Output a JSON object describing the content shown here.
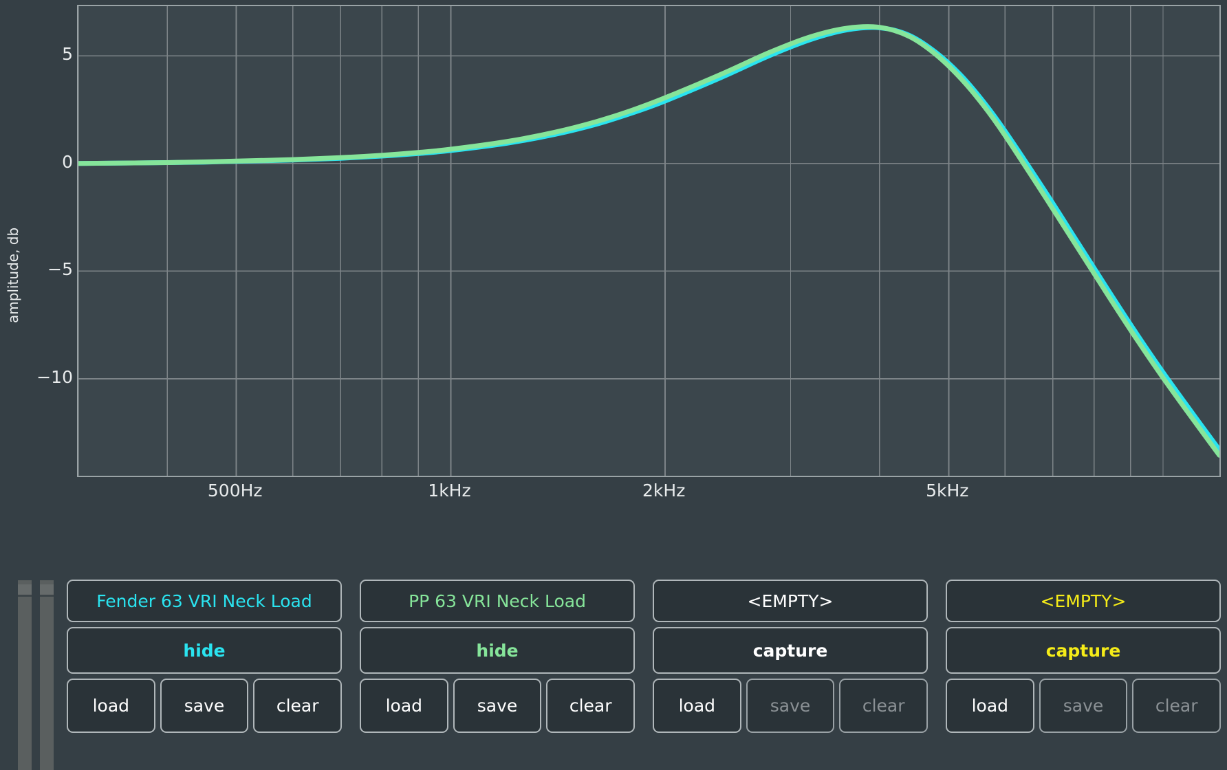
{
  "plot": {
    "y_axis_title": "amplitude, db",
    "y_ticks": [
      {
        "label": "5",
        "value": 5
      },
      {
        "label": "0",
        "value": 0
      },
      {
        "label": "−5",
        "value": -5
      },
      {
        "label": "−10",
        "value": -10
      }
    ],
    "x_ticks": [
      {
        "label": "500Hz",
        "value": 500
      },
      {
        "label": "1kHz",
        "value": 1000
      },
      {
        "label": "2kHz",
        "value": 2000
      },
      {
        "label": "5kHz",
        "value": 5000
      }
    ],
    "colors": {
      "background": "#353f45",
      "plot_background": "#3b464c",
      "grid": "#7d8488",
      "axis_border": "#9aa3a6",
      "tick_text": "#e9eced",
      "curve_cyan": "#2ae4f0",
      "curve_green": "#86e59a"
    }
  },
  "chart_data": {
    "type": "line",
    "title": "",
    "xlabel": "",
    "ylabel": "amplitude, db",
    "xscale": "log",
    "xlim": [
      300,
      12000
    ],
    "ylim": [
      -14.5,
      7.3
    ],
    "grid": true,
    "legend_position": "none",
    "x_ticks": [
      500,
      1000,
      2000,
      5000
    ],
    "x_tick_labels": [
      "500Hz",
      "1kHz",
      "2kHz",
      "5kHz"
    ],
    "y_ticks": [
      5,
      0,
      -5,
      -10
    ],
    "y_tick_labels": [
      "5",
      "0",
      "−5",
      "−10"
    ],
    "x": [
      300,
      350,
      400,
      450,
      500,
      600,
      700,
      800,
      900,
      1000,
      1200,
      1400,
      1600,
      1800,
      2000,
      2400,
      2800,
      3200,
      3600,
      4000,
      4400,
      4800,
      5200,
      5600,
      6000,
      6800,
      7600,
      8400,
      9200,
      10000,
      11000,
      12000
    ],
    "series": [
      {
        "name": "Fender 63 VRI Neck Load",
        "color": "#2ae4f0",
        "values": [
          0.0,
          0.02,
          0.04,
          0.06,
          0.1,
          0.16,
          0.24,
          0.34,
          0.46,
          0.6,
          0.94,
          1.35,
          1.82,
          2.35,
          2.9,
          4.0,
          5.0,
          5.75,
          6.2,
          6.3,
          5.95,
          5.15,
          4.1,
          2.85,
          1.5,
          -1.2,
          -3.7,
          -5.95,
          -7.95,
          -9.7,
          -11.6,
          -13.3
        ]
      },
      {
        "name": "PP 63 VRI Neck Load",
        "color": "#86e59a",
        "values": [
          0.0,
          0.02,
          0.04,
          0.07,
          0.11,
          0.18,
          0.27,
          0.38,
          0.51,
          0.66,
          1.02,
          1.45,
          1.94,
          2.48,
          3.05,
          4.15,
          5.15,
          5.88,
          6.28,
          6.32,
          5.9,
          5.05,
          3.95,
          2.68,
          1.3,
          -1.45,
          -3.95,
          -6.2,
          -8.2,
          -9.95,
          -11.85,
          -13.55
        ]
      }
    ]
  },
  "faders": [
    {
      "name": "fader-left"
    },
    {
      "name": "fader-right"
    }
  ],
  "slots": [
    {
      "title": "Fender 63 VRI Neck Load",
      "title_color": "#2ae4f0",
      "action_label": "hide",
      "action_color": "#2ae4f0",
      "load_label": "load",
      "save_label": "save",
      "clear_label": "clear",
      "load_enabled": true,
      "save_enabled": true,
      "clear_enabled": true
    },
    {
      "title": "PP 63 VRI Neck Load",
      "title_color": "#86e59a",
      "action_label": "hide",
      "action_color": "#86e59a",
      "load_label": "load",
      "save_label": "save",
      "clear_label": "clear",
      "load_enabled": true,
      "save_enabled": true,
      "clear_enabled": true
    },
    {
      "title": "<EMPTY>",
      "title_color": "#ffffff",
      "action_label": "capture",
      "action_color": "#ffffff",
      "load_label": "load",
      "save_label": "save",
      "clear_label": "clear",
      "load_enabled": true,
      "save_enabled": false,
      "clear_enabled": false
    },
    {
      "title": "<EMPTY>",
      "title_color": "#f5ec18",
      "action_label": "capture",
      "action_color": "#f5ec18",
      "load_label": "load",
      "save_label": "save",
      "clear_label": "clear",
      "load_enabled": true,
      "save_enabled": false,
      "clear_enabled": false
    }
  ]
}
